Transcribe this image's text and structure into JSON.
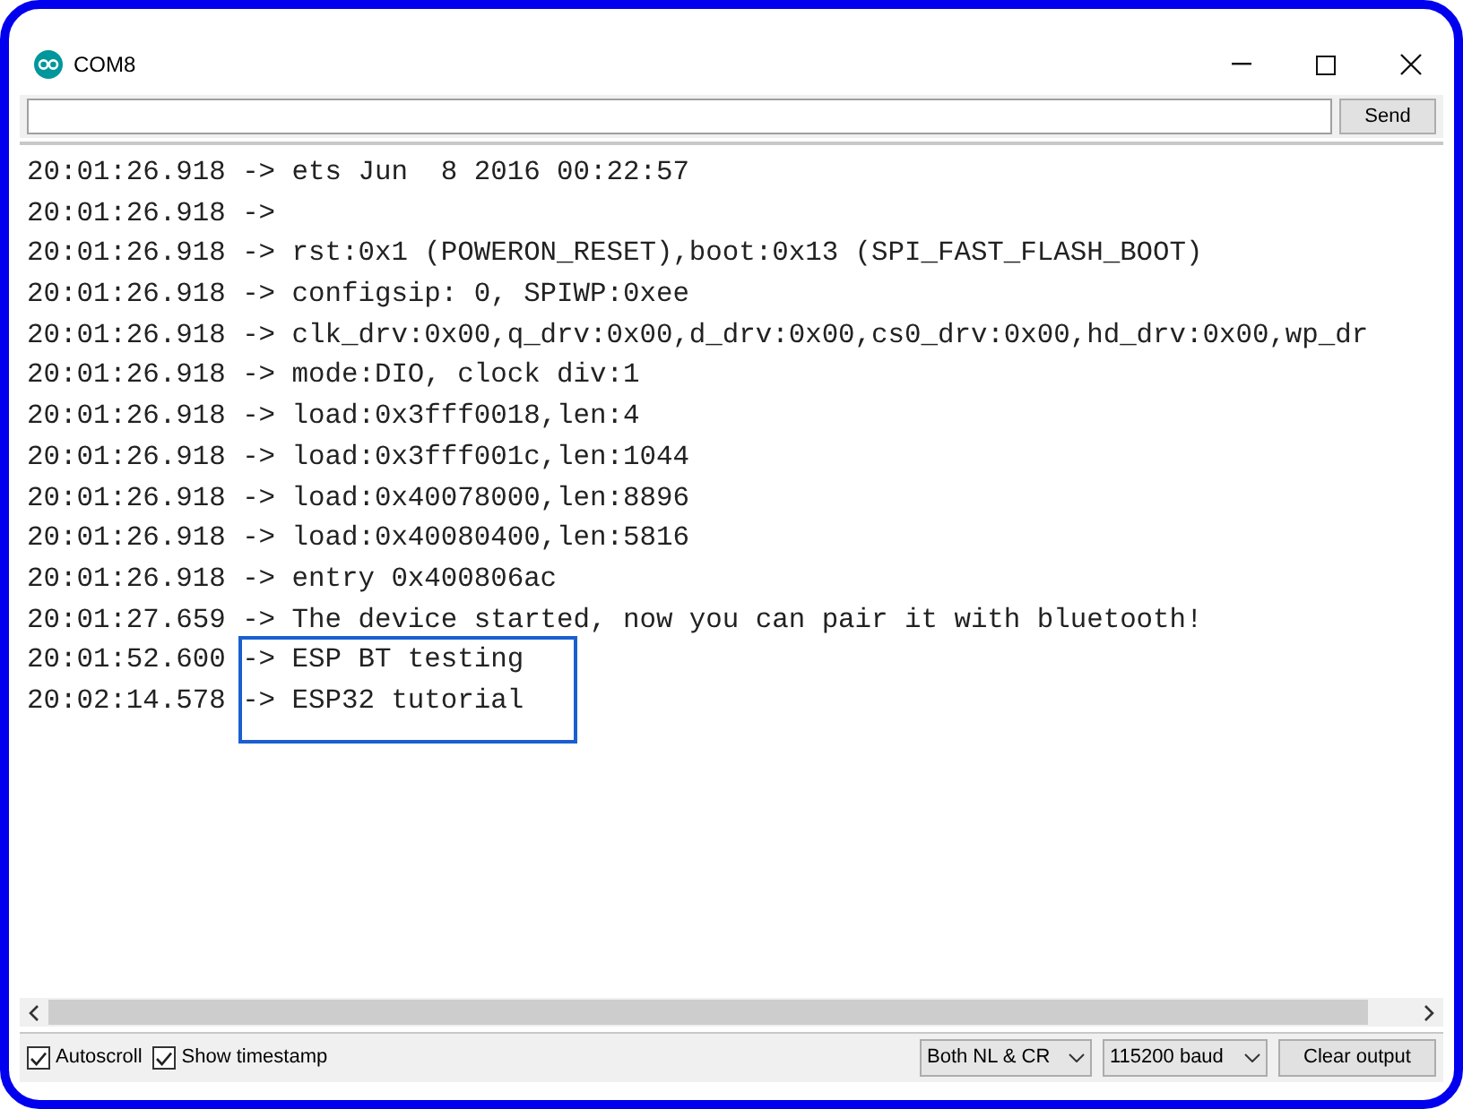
{
  "window": {
    "title": "COM8"
  },
  "send_button": "Send",
  "output_lines": [
    {
      "time": "20:01:26.918",
      "arrow": "->",
      "text": "ets Jun  8 2016 00:22:57",
      "highlighted": false
    },
    {
      "time": "20:01:26.918",
      "arrow": "->",
      "highlighted": false
    },
    {
      "time": "20:01:26.918",
      "arrow": "->",
      "text": "rst:0x1 (POWERON_RESET),boot:0x13 (SPI_FAST_FLASH_BOOT)",
      "highlighted": false
    },
    {
      "time": "20:01:26.918",
      "arrow": "->",
      "text": "configsip: 0, SPIWP:0xee",
      "highlighted": false
    },
    {
      "time": "20:01:26.918",
      "arrow": "->",
      "text": "clk_drv:0x00,q_drv:0x00,d_drv:0x00,cs0_drv:0x00,hd_drv:0x00,wp_dr",
      "highlighted": false
    },
    {
      "time": "20:01:26.918",
      "arrow": "->",
      "text": "mode:DIO, clock div:1",
      "highlighted": false
    },
    {
      "time": "20:01:26.918",
      "arrow": "->",
      "text": "load:0x3fff0018,len:4",
      "highlighted": false
    },
    {
      "time": "20:01:26.918",
      "arrow": "->",
      "text": "load:0x3fff001c,len:1044",
      "highlighted": false
    },
    {
      "time": "20:01:26.918",
      "arrow": "->",
      "text": "load:0x40078000,len:8896",
      "highlighted": false
    },
    {
      "time": "20:01:26.918",
      "arrow": "->",
      "text": "load:0x40080400,len:5816",
      "highlighted": false
    },
    {
      "time": "20:01:26.918",
      "arrow": "->",
      "text": "entry 0x400806ac",
      "highlighted": false
    },
    {
      "time": "20:01:27.659",
      "arrow": "->",
      "text": "The device started, now you can pair it with bluetooth!",
      "highlighted": false
    },
    {
      "time": "20:01:52.600",
      "arrow": "->",
      "text": "ESP BT testing",
      "highlighted": true
    },
    {
      "time": "20:02:14.578",
      "arrow": "->",
      "text": "ESP32 tutorial",
      "highlighted": true
    }
  ],
  "options": [
    {
      "label": "Autoscroll",
      "checked": true
    },
    {
      "label": "Show timestamp",
      "checked": true
    }
  ],
  "line_ending": "Both NL & CR",
  "baud_rate": "115200 baud",
  "clear_button": "Clear output"
}
